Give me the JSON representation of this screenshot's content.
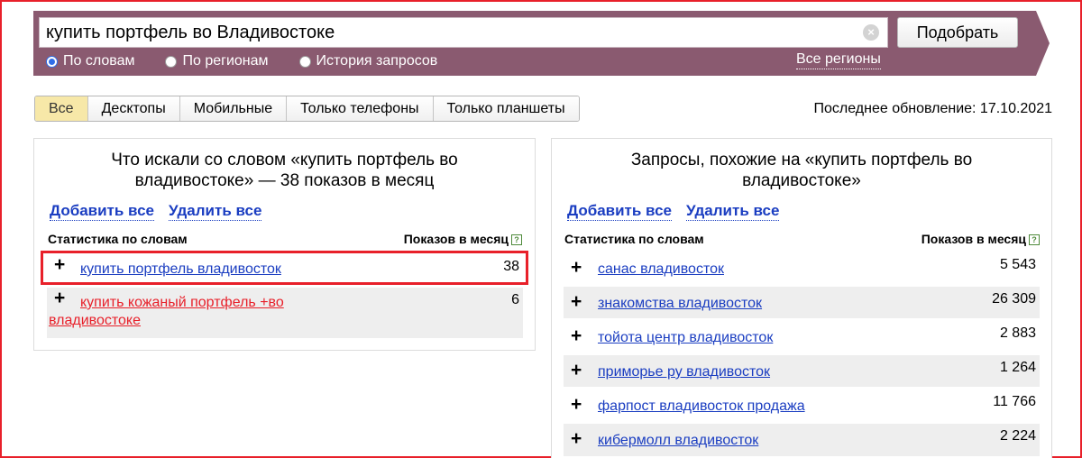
{
  "search": {
    "query": "купить портфель во Владивостоке",
    "button_label": "Подобрать",
    "clear_icon": "clear-icon",
    "modes": [
      {
        "label": "По словам",
        "checked": true
      },
      {
        "label": "По регионам",
        "checked": false
      },
      {
        "label": "История запросов",
        "checked": false
      }
    ],
    "regions_link": "Все регионы",
    "band_color": "#8a5a70"
  },
  "tabs": [
    {
      "label": "Все",
      "active": true
    },
    {
      "label": "Десктопы",
      "active": false
    },
    {
      "label": "Мобильные",
      "active": false
    },
    {
      "label": "Только телефоны",
      "active": false
    },
    {
      "label": "Только планшеты",
      "active": false
    }
  ],
  "update_text": "Последнее обновление: 17.10.2021",
  "left_panel": {
    "title_line1": "Что искали со словом «купить портфель во",
    "title_line2": "владивостоке» — 38 показов в месяц",
    "add_all": "Добавить все",
    "remove_all": "Удалить все",
    "col_words": "Статистика по словам",
    "col_count": "Показов в месяц",
    "rows": [
      {
        "text": "купить портфель владивосток",
        "count": "38"
      },
      {
        "text_line1": "купить кожаный портфель +во",
        "text_line2": "владивостоке",
        "count": "6"
      }
    ]
  },
  "right_panel": {
    "title_line1": "Запросы, похожие на «купить портфель во",
    "title_line2": "владивостоке»",
    "add_all": "Добавить все",
    "remove_all": "Удалить все",
    "col_words": "Статистика по словам",
    "col_count": "Показов в месяц",
    "rows": [
      {
        "text": "санас владивосток",
        "count": "5 543"
      },
      {
        "text": "знакомства владивосток",
        "count": "26 309"
      },
      {
        "text": "тойота центр владивосток",
        "count": "2 883"
      },
      {
        "text": "приморье ру владивосток",
        "count": "1 264"
      },
      {
        "text": "фарпост владивосток продажа",
        "count": "11 766"
      },
      {
        "text": "кибермолл владивосток",
        "count": "2 224"
      }
    ]
  },
  "help_icon": "help-icon",
  "colors": {
    "accent_red": "#e8202a",
    "link_blue": "#1a3dc1",
    "active_tab": "#f7e8a8"
  }
}
